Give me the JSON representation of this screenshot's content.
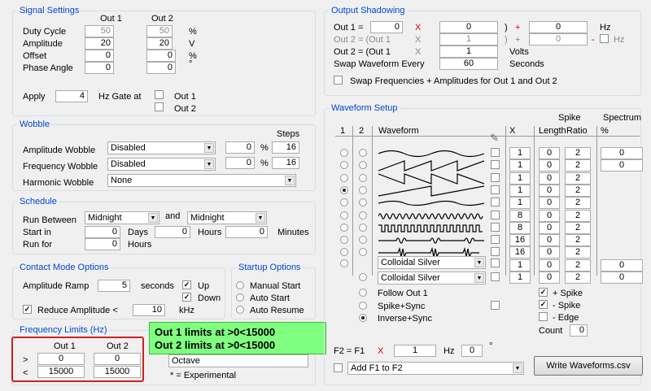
{
  "signal": {
    "title": "Signal Settings",
    "out1": "Out 1",
    "out2": "Out 2",
    "rows": [
      {
        "label": "Duty Cycle",
        "v1": "50",
        "v2": "50",
        "unit": "%"
      },
      {
        "label": "Amplitude",
        "v1": "20",
        "v2": "20",
        "unit": "V"
      },
      {
        "label": "Offset",
        "v1": "0",
        "v2": "0",
        "unit": "%"
      },
      {
        "label": "Phase Angle",
        "v1": "0",
        "v2": "0",
        "unit": "°"
      }
    ],
    "apply_label": "Apply",
    "apply_value": "4",
    "gate_label": "Hz Gate at",
    "gate_out1": "Out 1",
    "gate_out2": "Out 2"
  },
  "wobble": {
    "title": "Wobble",
    "steps_label": "Steps",
    "rows": [
      {
        "label": "Amplitude Wobble",
        "select": "Disabled",
        "value": "0",
        "unit": "%",
        "steps": "16"
      },
      {
        "label": "Frequency Wobble",
        "select": "Disabled",
        "value": "0",
        "unit": "%",
        "steps": "16"
      }
    ],
    "harmonic_label": "Harmonic Wobble",
    "harmonic_select": "None"
  },
  "schedule": {
    "title": "Schedule",
    "run_between": "Run Between",
    "from": "Midnight",
    "and": "and",
    "to": "Midnight",
    "start_in": "Start in",
    "days_value": "0",
    "days": "Days",
    "hours_value": "0",
    "hours": "Hours",
    "minutes_value": "0",
    "minutes": "Minutes",
    "run_for": "Run for",
    "run_for_value": "0",
    "run_for_unit": "Hours"
  },
  "contact": {
    "title": "Contact Mode Options",
    "ramp_label": "Amplitude Ramp",
    "ramp_value": "5",
    "ramp_unit": "seconds",
    "up": "Up",
    "down": "Down",
    "reduce_label": "Reduce Amplitude <",
    "reduce_value": "10",
    "reduce_unit": "kHz"
  },
  "startup": {
    "title": "Startup Options",
    "options": [
      "Manual Start",
      "Auto Start",
      "Auto Resume"
    ]
  },
  "freq_limits": {
    "title": "Frequency Limits (Hz)",
    "out1": "Out 1",
    "out2": "Out 2",
    "gt": ">",
    "lt": "<",
    "min1": "0",
    "min2": "0",
    "max1": "15000",
    "max2": "15000",
    "octave": "Octave",
    "experimental": "* = Experimental"
  },
  "tooltip": {
    "line1": "Out 1 limits at >0<15000",
    "line2": "Out 2 limits at >0<15000"
  },
  "output_shadowing": {
    "title": "Output Shadowing",
    "row1": {
      "label": "Out 1 =",
      "a": "0",
      "x": "X",
      "b": "0",
      "close": ")",
      "plus": "+",
      "c": "0",
      "unit": "Hz"
    },
    "row2": {
      "label": "Out 2 = (Out 1",
      "x": "X",
      "b": "1",
      "close": ")",
      "plus": "+",
      "c": "0",
      "minus": "-",
      "unit": "Hz"
    },
    "row3": {
      "label": "Out 2 = (Out 1",
      "x": "X",
      "b": "1",
      "unit": "Volts"
    },
    "swap_label": "Swap Waveform Every",
    "swap_value": "60",
    "swap_unit": "Seconds",
    "swap_check": "Swap Frequencies + Amplitudes for Out 1 and Out 2"
  },
  "waveform": {
    "title": "Waveform Setup",
    "col1": "1",
    "col2": "2",
    "col_waveform": "Waveform",
    "col_x": "X",
    "col_spike": "Spike",
    "col_length": "Length",
    "col_ratio": "Ratio",
    "col_spectrum": "Spectrum",
    "col_pct": "%",
    "rows": [
      {
        "x": "1",
        "len": "0",
        "ratio": "2",
        "spec": "0"
      },
      {
        "x": "1",
        "len": "0",
        "ratio": "2",
        "spec": "0"
      },
      {
        "x": "1",
        "len": "0",
        "ratio": "2",
        "spec": ""
      },
      {
        "x": "1",
        "len": "0",
        "ratio": "2",
        "spec": ""
      },
      {
        "x": "1",
        "len": "0",
        "ratio": "2",
        "spec": ""
      },
      {
        "x": "8",
        "len": "0",
        "ratio": "2",
        "spec": ""
      },
      {
        "x": "8",
        "len": "0",
        "ratio": "2",
        "spec": ""
      },
      {
        "x": "16",
        "len": "0",
        "ratio": "2",
        "spec": ""
      },
      {
        "x": "16",
        "len": "0",
        "ratio": "2",
        "spec": ""
      },
      {
        "x": "1",
        "len": "0",
        "ratio": "2",
        "spec": "0"
      },
      {
        "x": "1",
        "len": "0",
        "ratio": "2",
        "spec": "0"
      }
    ],
    "colloidal1": "Colloidal Silver",
    "colloidal2": "Colloidal Silver",
    "follow": "Follow Out 1",
    "spike_sync": "Spike+Sync",
    "inverse_sync": "Inverse+Sync",
    "plus_spike": "+ Spike",
    "minus_spike": "- Spike",
    "edge": "- Edge",
    "count_label": "Count",
    "count_value": "0",
    "f2_label": "F2 = F1",
    "f2_x": "X",
    "f2_value": "1",
    "f2_hz": "Hz",
    "f2_phase": "0",
    "f2_deg": "°",
    "add_select": "Add F1 to F2",
    "write_button": "Write Waveforms.csv"
  }
}
